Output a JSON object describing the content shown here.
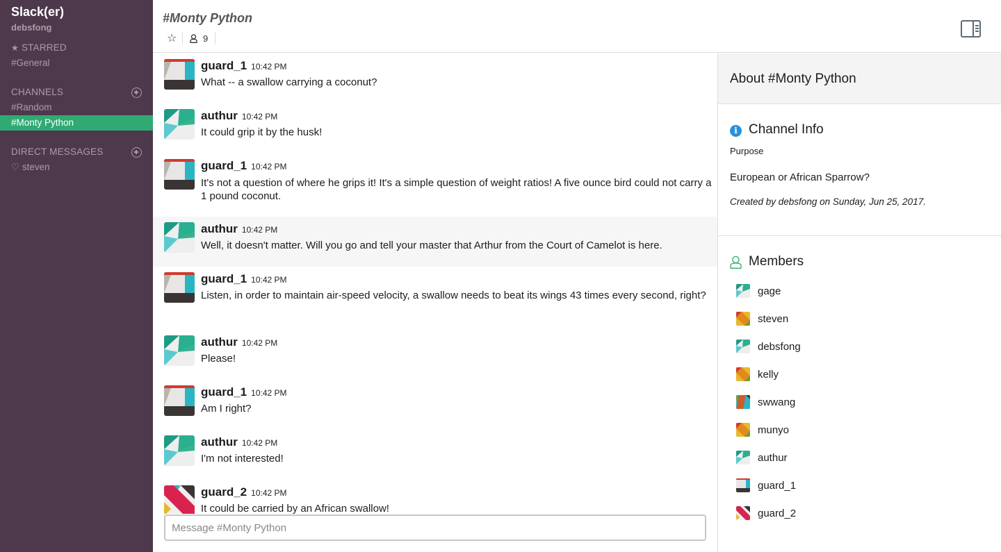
{
  "sidebar": {
    "team_name": "Slack(er)",
    "user_name": "debsfong",
    "starred_label": "STARRED",
    "starred_items": [
      "#General"
    ],
    "channels_label": "CHANNELS",
    "channels": [
      "#Random",
      "#Monty Python"
    ],
    "active_channel": "#Monty Python",
    "dm_label": "DIRECT MESSAGES",
    "dms": [
      "♡ steven"
    ]
  },
  "header": {
    "channel_title": "#Monty Python",
    "member_count": "9"
  },
  "messages": [
    {
      "user": "guard_1",
      "time": "10:42 PM",
      "text": "What -- a swallow carrying a coconut?"
    },
    {
      "user": "authur",
      "time": "10:42 PM",
      "text": "It could grip it by the husk!"
    },
    {
      "user": "guard_1",
      "time": "10:42 PM",
      "text": "It's not a question of where he grips it! It's a simple question of weight ratios! A five ounce bird could not carry a 1 pound coconut."
    },
    {
      "user": "authur",
      "time": "10:42 PM",
      "text": "Well, it doesn't matter. Will you go and tell your master that Arthur from the Court of Camelot is here."
    },
    {
      "user": "guard_1",
      "time": "10:42 PM",
      "text": "Listen, in order to maintain air-speed velocity, a swallow needs to beat its wings 43 times every second, right?"
    },
    {
      "user": "authur",
      "time": "10:42 PM",
      "text": "Please!"
    },
    {
      "user": "guard_1",
      "time": "10:42 PM",
      "text": "Am I right?"
    },
    {
      "user": "authur",
      "time": "10:42 PM",
      "text": "I'm not interested!"
    },
    {
      "user": "guard_2",
      "time": "10:42 PM",
      "text": "It could be carried by an African swallow!"
    }
  ],
  "composer": {
    "placeholder": "Message #Monty Python"
  },
  "about": {
    "title": "About #Monty Python",
    "channel_info_title": "Channel Info",
    "purpose_label": "Purpose",
    "purpose_value": "European or African Sparrow?",
    "created_text": "Created by debsfong on Sunday, Jun 25, 2017.",
    "members_title": "Members",
    "members": [
      "gage",
      "steven",
      "debsfong",
      "kelly",
      "swwang",
      "munyo",
      "authur",
      "guard_1",
      "guard_2"
    ]
  },
  "colors": {
    "sidebar_bg": "#4d394b",
    "active_channel": "#2faa73",
    "sidebar_text": "#ab9ba9",
    "info_icon": "#2a8fdb",
    "members_icon": "#2faa73"
  }
}
